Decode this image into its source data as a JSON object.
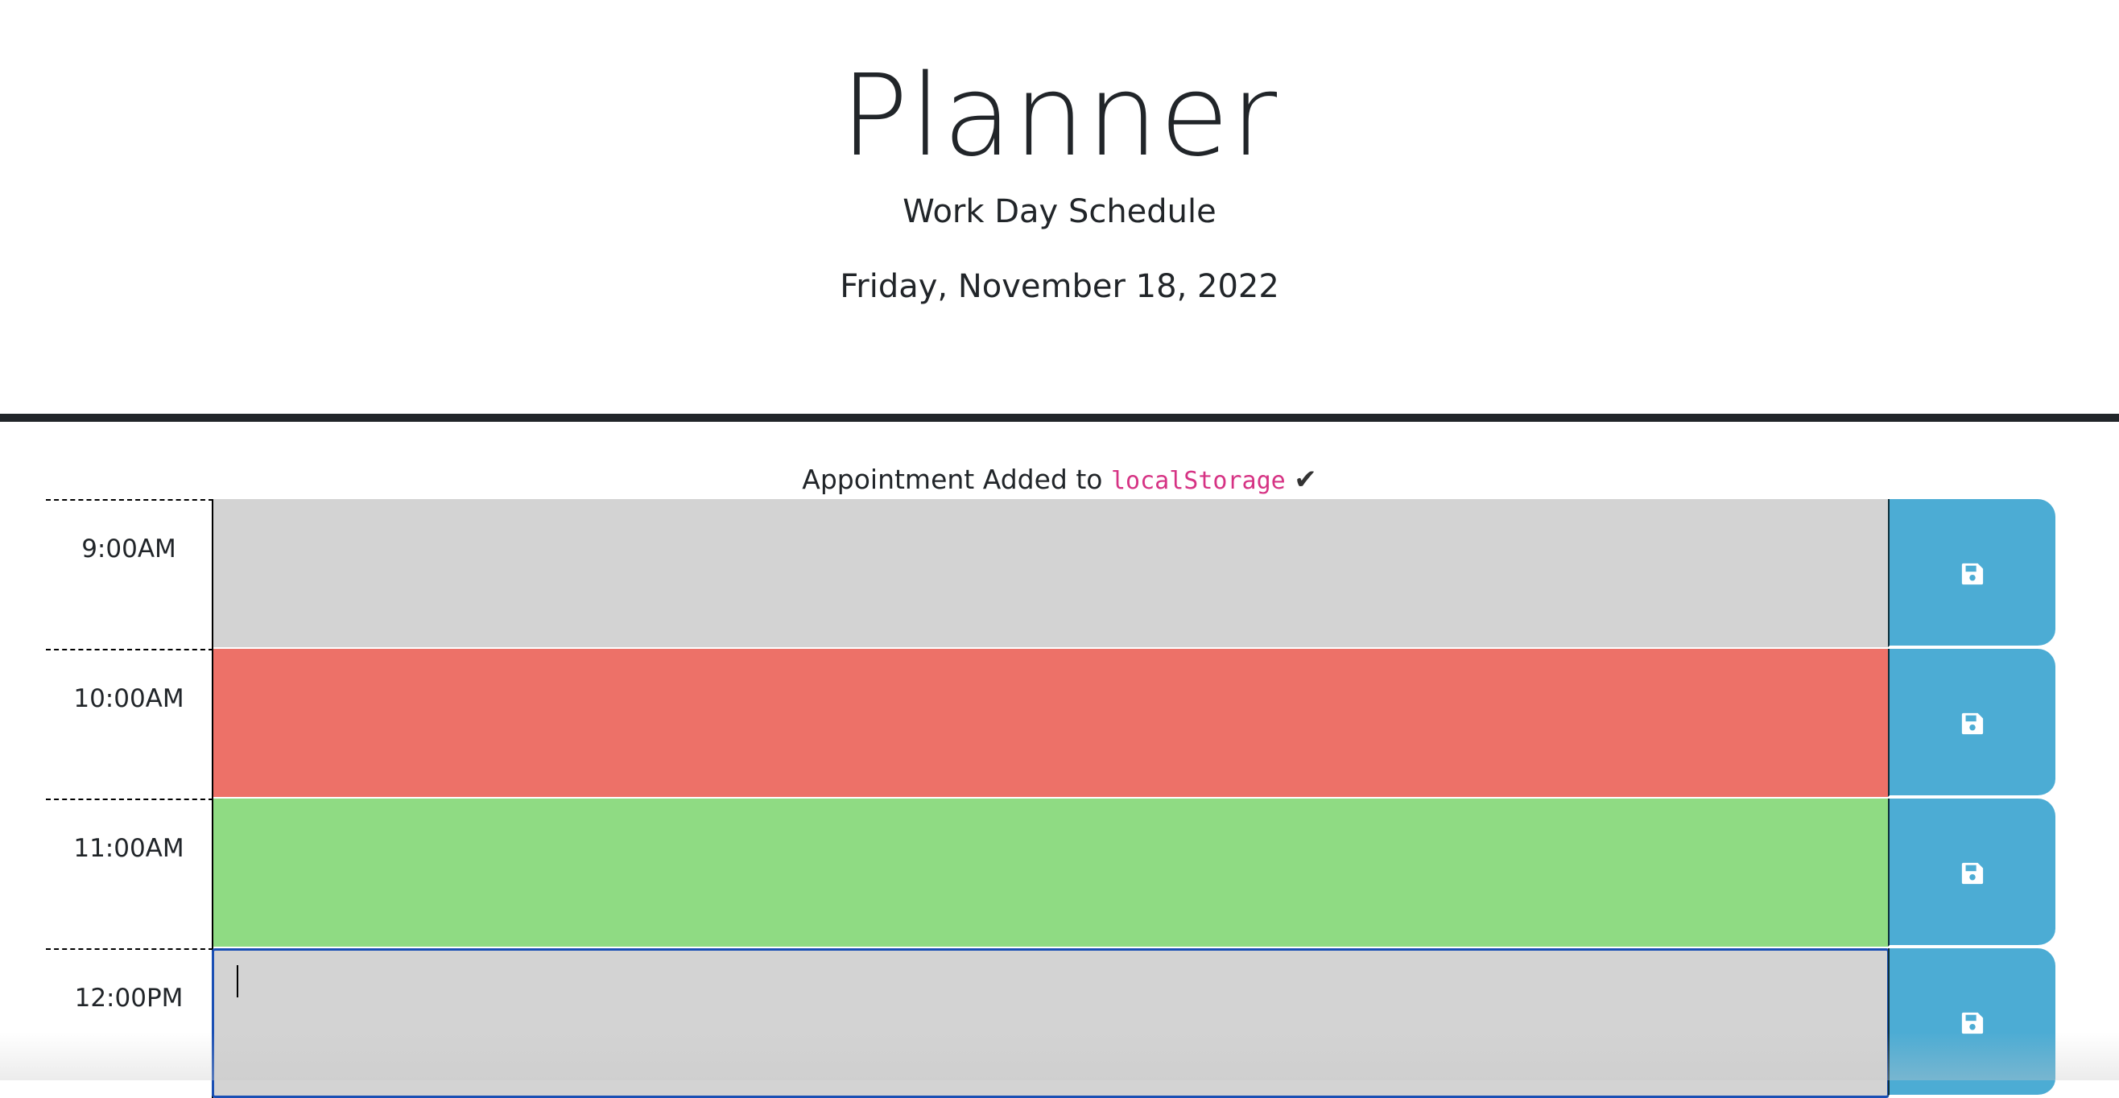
{
  "header": {
    "title": "Planner",
    "subtitle": "Work Day Schedule",
    "current_date": "Friday, November 18, 2022"
  },
  "notice": {
    "text": "Appointment Added to ",
    "code": "localStorage",
    "check": "✔"
  },
  "colors": {
    "past": "#d3d3d3",
    "present": "#ed7168",
    "future": "#8fdb83",
    "save_button": "#4cacd4"
  },
  "rows": [
    {
      "hour": "9:00AM",
      "status": "past",
      "text": "",
      "save_icon": "save-icon"
    },
    {
      "hour": "10:00AM",
      "status": "present",
      "text": "",
      "save_icon": "save-icon"
    },
    {
      "hour": "11:00AM",
      "status": "future",
      "text": "",
      "save_icon": "save-icon"
    },
    {
      "hour": "12:00PM",
      "status": "past",
      "text": "",
      "save_icon": "save-icon",
      "focused": true
    }
  ]
}
